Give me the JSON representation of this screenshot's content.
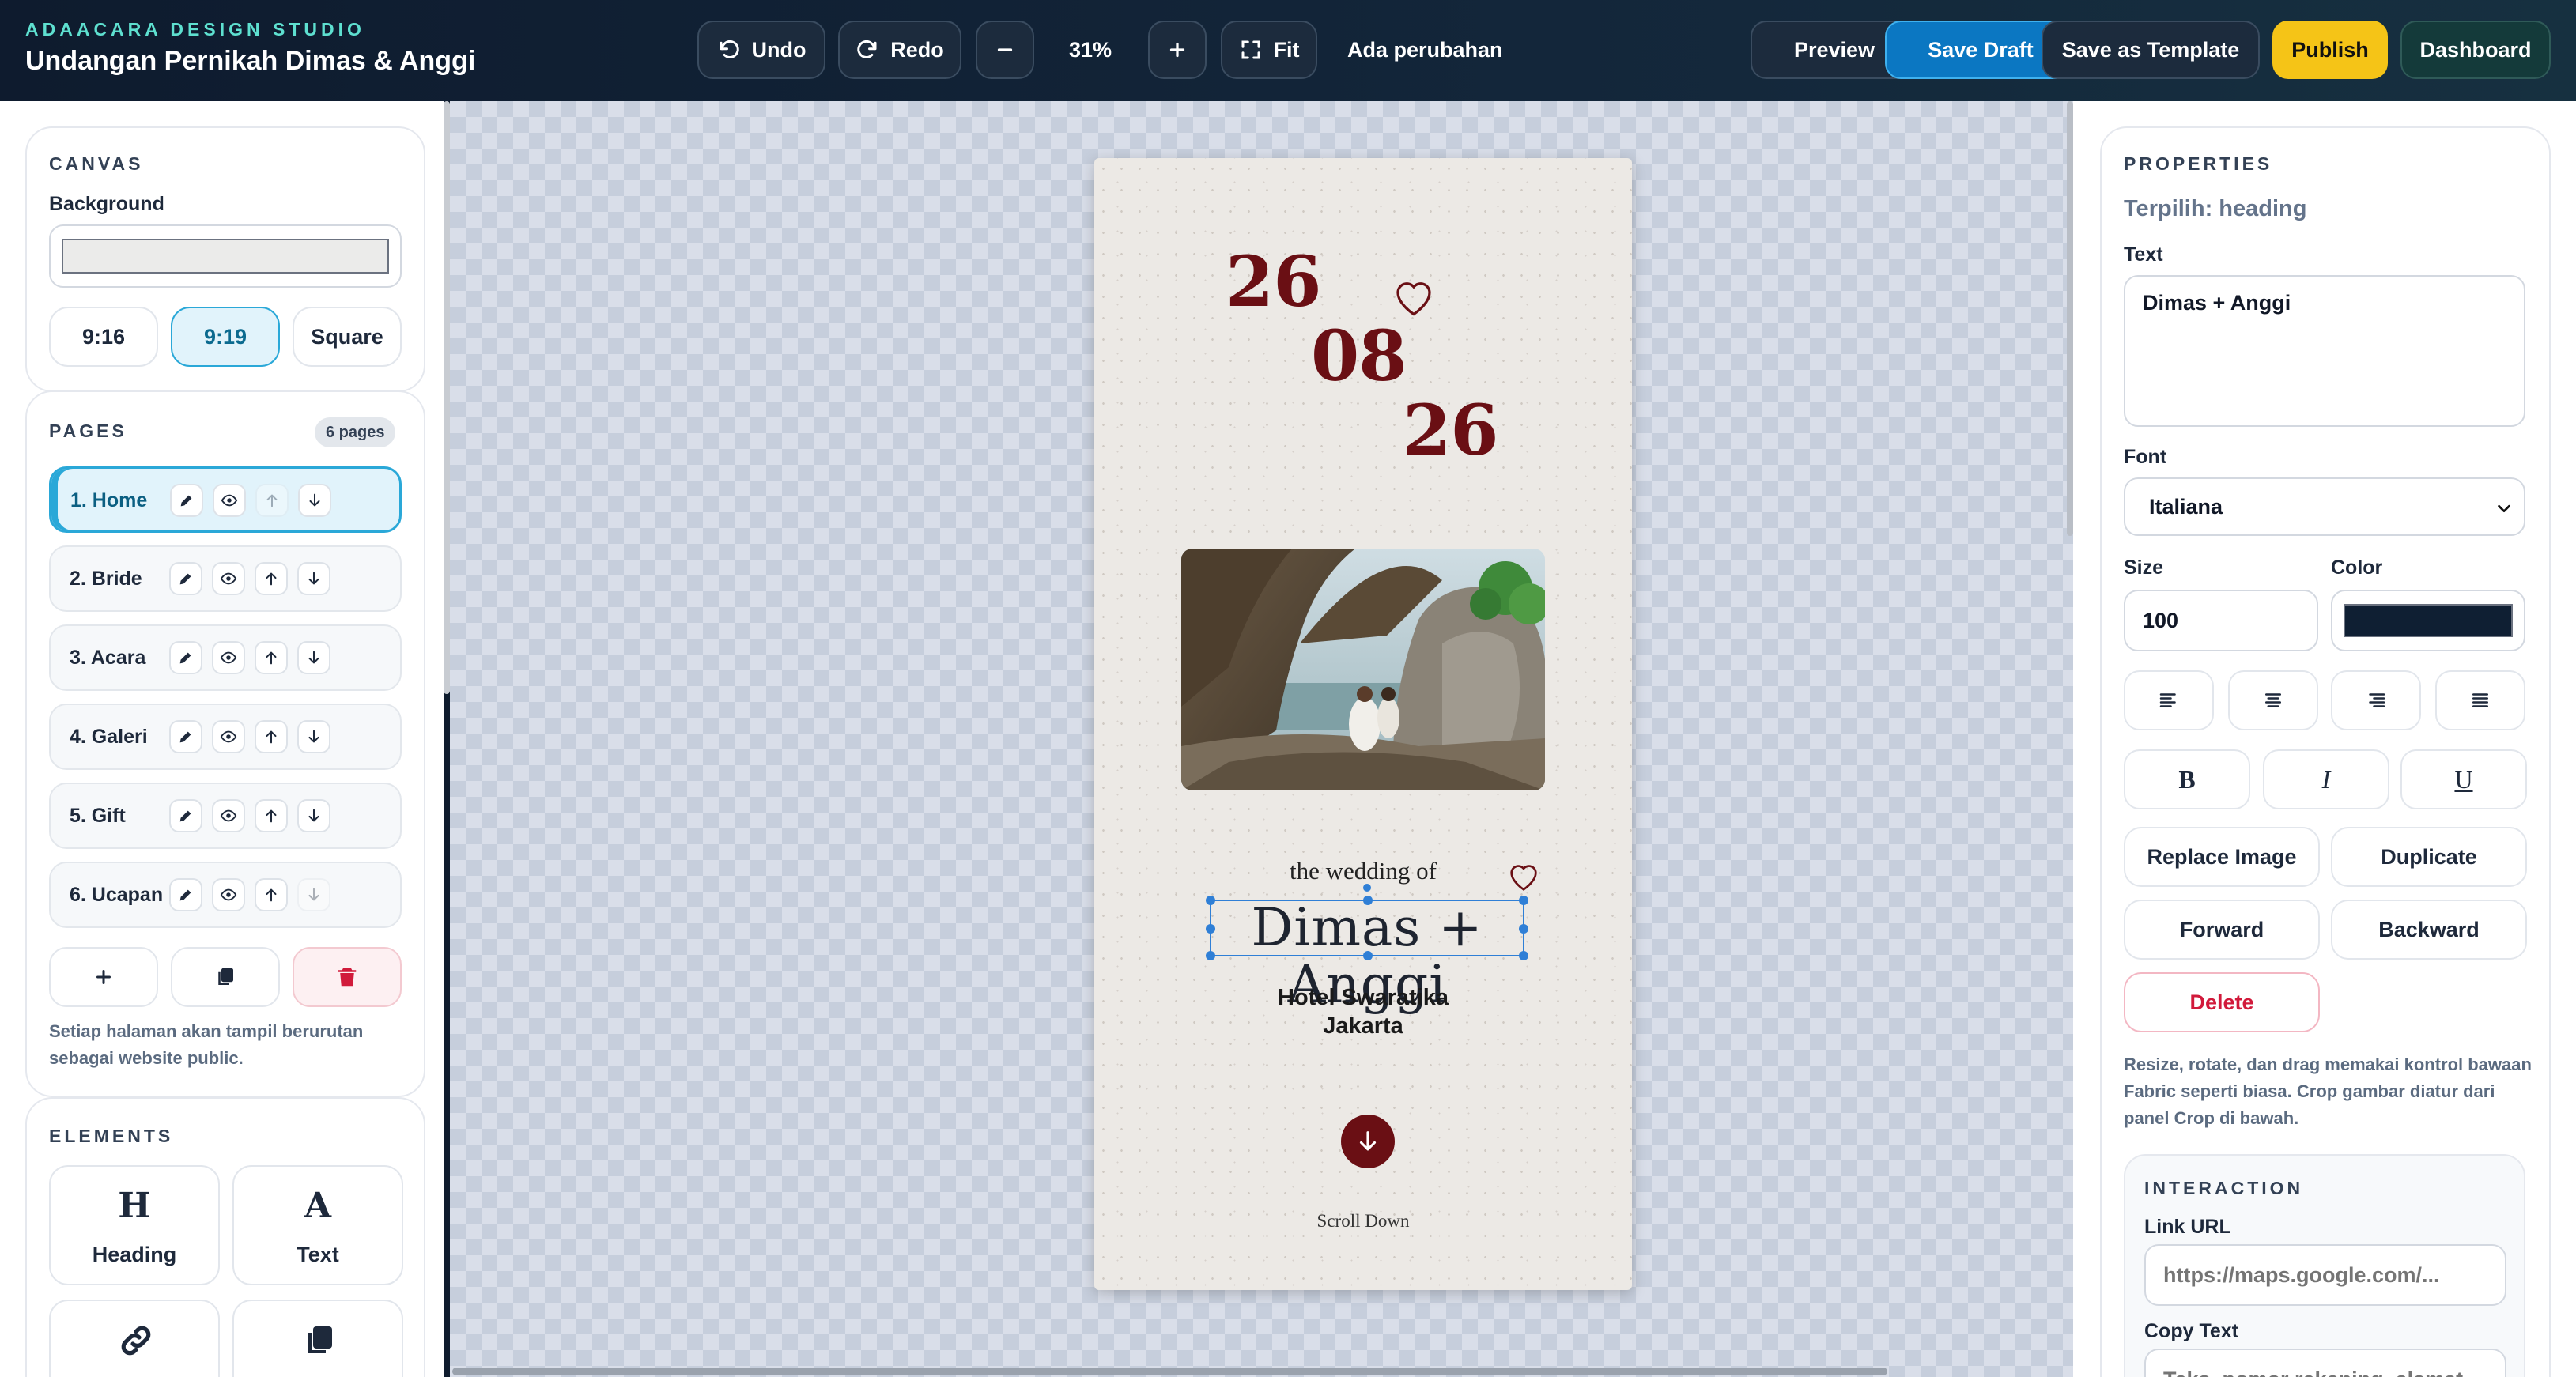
{
  "app": {
    "brand": "ADAACARA DESIGN STUDIO",
    "document_title": "Undangan Pernikah Dimas & Anggi"
  },
  "toolbar": {
    "undo": "Undo",
    "redo": "Redo",
    "zoom": "31%",
    "fit": "Fit",
    "status": "Ada perubahan",
    "preview": "Preview",
    "save_draft": "Save Draft",
    "save_template": "Save as Template",
    "publish": "Publish",
    "dashboard": "Dashboard"
  },
  "canvas_panel": {
    "title": "CANVAS",
    "background_label": "Background",
    "background_color": "#ebebea",
    "ratios": [
      "9:16",
      "9:19",
      "Square"
    ],
    "active_ratio": "9:19"
  },
  "pages_panel": {
    "title": "PAGES",
    "count": "6 pages",
    "pages": [
      "1. Home",
      "2. Bride",
      "3. Acara",
      "4. Galeri",
      "5. Gift",
      "6. Ucapan"
    ],
    "active_page": "1. Home",
    "hint": "Setiap halaman akan tampil berurutan sebagai website public."
  },
  "elements_panel": {
    "title": "ELEMENTS",
    "items": [
      {
        "icon": "H",
        "label": "Heading"
      },
      {
        "icon": "A",
        "label": "Text"
      },
      {
        "icon": "link-icon",
        "label": ""
      },
      {
        "icon": "copy-icon",
        "label": ""
      }
    ]
  },
  "invitation": {
    "date_day": "26",
    "date_month": "08",
    "date_year": "26",
    "wedding_of": "the wedding of",
    "couple": "Dimas + Anggi",
    "venue_line1": "Hotel Swaratika",
    "venue_line2": "Jakarta",
    "scroll_label": "Scroll Down",
    "accent_color": "#6a0f14"
  },
  "properties": {
    "title": "PROPERTIES",
    "selected": "Terpilih: heading",
    "text_label": "Text",
    "text_value": "Dimas + Anggi",
    "font_label": "Font",
    "font_value": "Italiana",
    "size_label": "Size",
    "size_value": "100",
    "color_label": "Color",
    "color_value": "#0f1f33",
    "replace_image": "Replace Image",
    "duplicate": "Duplicate",
    "forward": "Forward",
    "backward": "Backward",
    "delete": "Delete",
    "hint": "Resize, rotate, dan drag memakai kontrol bawaan Fabric seperti biasa. Crop gambar diatur dari panel Crop di bawah.",
    "interaction_title": "INTERACTION",
    "link_url_label": "Link URL",
    "link_url_placeholder": "https://maps.google.com/...",
    "copy_text_label": "Copy Text",
    "copy_text_placeholder": "Teks, nomor rekening, alamat..."
  },
  "colors": {
    "accent": "#2aa8d8",
    "publish": "#f5c417",
    "save_draft": "#0b77c2",
    "danger": "#d11a3b"
  }
}
